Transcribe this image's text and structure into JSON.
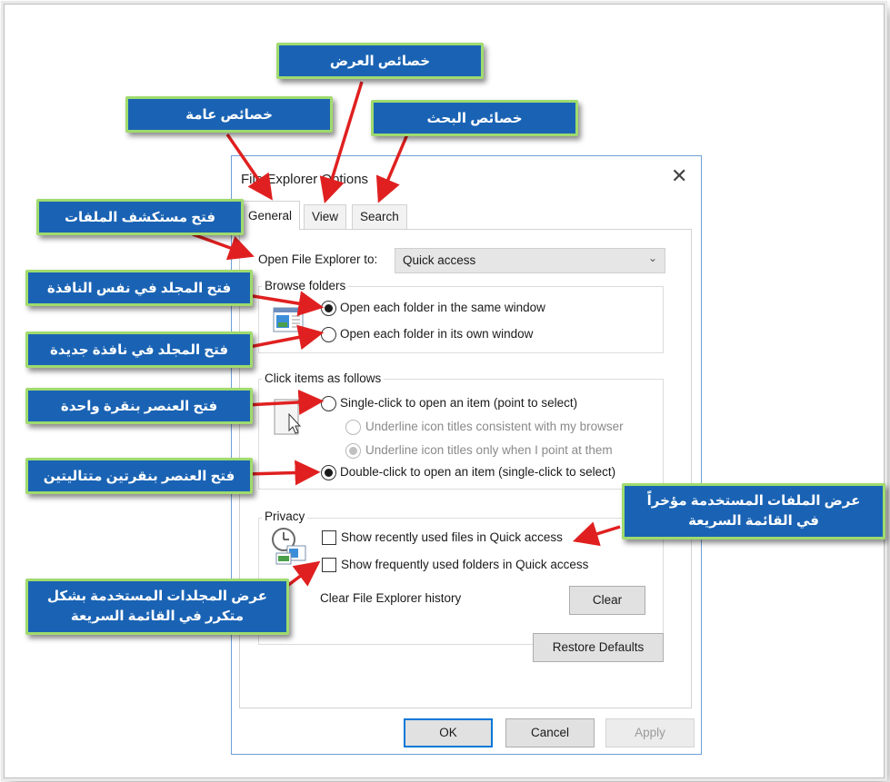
{
  "dialog": {
    "title": "File Explorer Options",
    "close": "✕",
    "tabs": [
      "General",
      "View",
      "Search"
    ],
    "open_label": "Open File Explorer to:",
    "open_value": "Quick access",
    "browse": {
      "title": "Browse folders",
      "same_window": "Open each folder in the same window",
      "own_window": "Open each folder in its own window"
    },
    "click": {
      "title": "Click items as follows",
      "single": "Single-click to open an item (point to select)",
      "underline_browser": "Underline icon titles consistent with my browser",
      "underline_point": "Underline icon titles only when I point at them",
      "double": "Double-click to open an item (single-click to select)"
    },
    "privacy": {
      "title": "Privacy",
      "recent_files": "Show recently used files in Quick access",
      "frequent_folders": "Show frequently used folders in Quick access",
      "clear_label": "Clear File Explorer history",
      "clear_button": "Clear"
    },
    "restore_defaults": "Restore Defaults",
    "ok": "OK",
    "cancel": "Cancel",
    "apply": "Apply"
  },
  "callouts": {
    "view_props": "خصائص العرض",
    "general_props": "خصائص عامة",
    "search_props": "خصائص البحث",
    "open_explorer": "فتح مستكشف الملفات",
    "same_window": "فتح المجلد في نفس النافذة",
    "new_window": "فتح المجلد في نافذة جديدة",
    "single_click": "فتح العنصر بنقرة واحدة",
    "double_click": "فتح العنصر بنقرتين متتاليتين",
    "recent_line1": "عرض الملفات المستخدمة مؤخراً",
    "recent_line2": "في القائمة السريعة",
    "frequent_line1": "عرض المجلدات المستخدمة بشكل",
    "frequent_line2": "متكرر في القائمة السريعة"
  },
  "colors": {
    "callout_fill": "#1a63b4",
    "callout_border": "#9fdb6e",
    "arrow": "#e02020"
  }
}
